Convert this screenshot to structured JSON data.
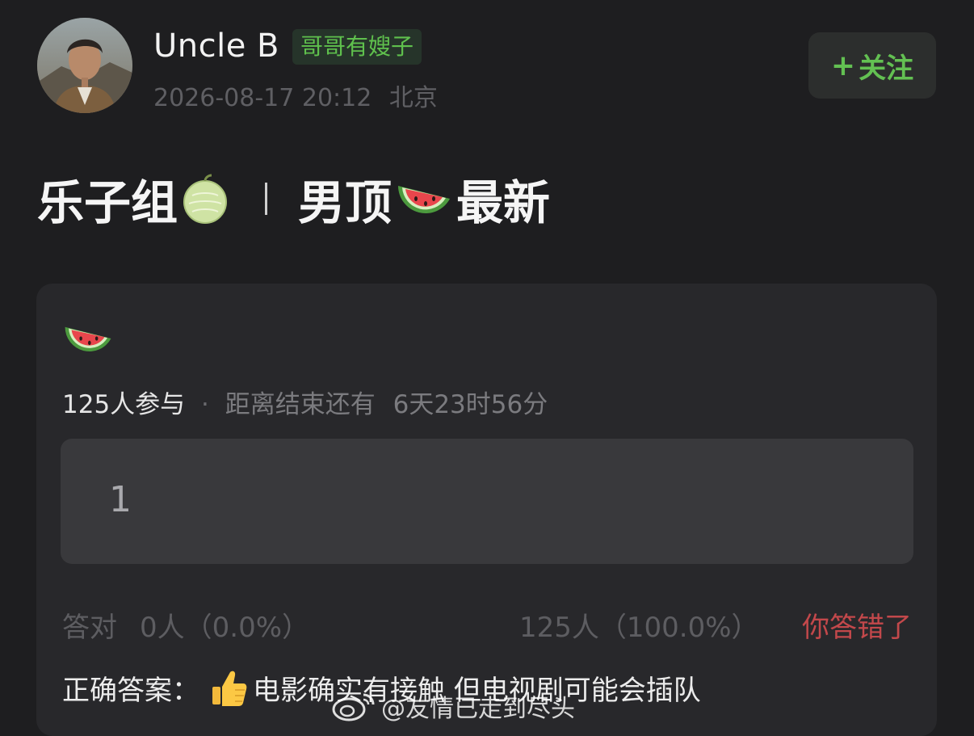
{
  "post": {
    "author": {
      "name": "Uncle B",
      "badge": "哥哥有嫂子",
      "timestamp": "2026-08-17 20:12",
      "location": "北京"
    },
    "follow_label": "关注",
    "title": {
      "part1": "乐子组",
      "part2": "男顶",
      "part3": "最新"
    }
  },
  "quiz": {
    "participants": "125人参与",
    "countdown_label": "距离结束还有",
    "countdown_value": "6天23时56分",
    "option_text": "1",
    "correct_label": "答对",
    "correct_value": "0人（0.0%）",
    "wrong_value": "125人（100.0%）",
    "your_result": "你答错了",
    "answer_label": "正确答案：",
    "answer_text": "电影确实有接触 但电视剧可能会插队"
  },
  "watermark": {
    "text": "@友情已走到尽头"
  },
  "colors": {
    "background": "#1e1e20",
    "card": "#28282b",
    "option": "#39393c",
    "accent_green": "#63c052",
    "badge_green": "#5fc04d",
    "wrong_red": "#c3484b"
  },
  "icons": {
    "title_icon_1": "melon-icon",
    "title_icon_2": "watermelon-icon",
    "card_icon": "watermelon-icon",
    "answer_icon": "thumbs-up-icon",
    "follow_icon": "plus-icon",
    "watermark_icon": "weibo-logo-icon"
  }
}
